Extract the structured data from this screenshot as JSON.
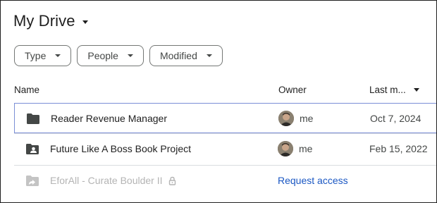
{
  "title": "My Drive",
  "filters": [
    {
      "label": "Type"
    },
    {
      "label": "People"
    },
    {
      "label": "Modified"
    }
  ],
  "columns": {
    "name": "Name",
    "owner": "Owner",
    "last_modified": "Last m..."
  },
  "files": [
    {
      "name": "Reader Revenue Manager",
      "owner": "me",
      "date": "Oct 7, 2024",
      "icon": "folder-icon",
      "selected": true
    },
    {
      "name": "Future Like A Boss Book Project",
      "owner": "me",
      "date": "Feb 15, 2022",
      "icon": "shared-folder-icon"
    },
    {
      "name": "EforAll - Curate Boulder II",
      "icon": "shortcut-folder-icon",
      "locked": true,
      "action": "Request access"
    }
  ],
  "colors": {
    "text": "#1f1f1f",
    "muted": "#444746",
    "link": "#1a57c3",
    "selection_border": "#7b8fd6",
    "disabled": "#b4b4b4"
  }
}
